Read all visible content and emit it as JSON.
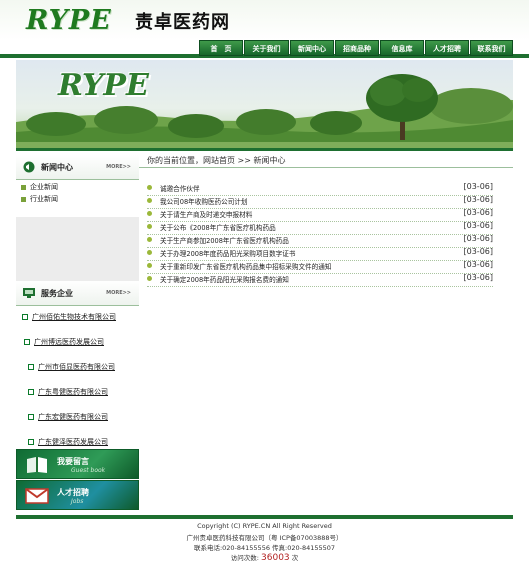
{
  "header": {
    "logo": "RYPE",
    "site_name": "责卓医药网"
  },
  "nav": [
    "首　页",
    "关于我们",
    "新闻中心",
    "招商品种",
    "信息库",
    "人才招聘",
    "联系我们"
  ],
  "banner": {
    "logo": "RYPE"
  },
  "sidebar": {
    "news_center": {
      "title": "新闻中心",
      "more": "MORE>>",
      "items": [
        "企业新闻",
        "行业新闻"
      ]
    },
    "services": {
      "title": "服务企业",
      "more": "MORE>>",
      "companies": [
        "广州佰佑生物技术有限公司",
        "广州博远医药发展公司",
        "广州市佰显医药有限公司",
        "广东粤健医药有限公司",
        "广东宏健医药有限公司",
        "广东健泽医药发展公司"
      ]
    },
    "guestbook": {
      "title": "我要留言",
      "sub": "Guest book"
    },
    "jobs": {
      "title": "人才招聘",
      "sub": "Jobs"
    }
  },
  "main": {
    "breadcrumb": "你的当前位置，网站首页 >> 新闻中心",
    "news": [
      {
        "title": "诚邀合作伙伴",
        "date": "[03-06]"
      },
      {
        "title": "我公司08年收购医药公司计划",
        "date": "[03-06]"
      },
      {
        "title": "关于请生产商及时递交申报材料",
        "date": "[03-06]"
      },
      {
        "title": "关于公布《2008年广东省医疗机构药品",
        "date": "[03-06]"
      },
      {
        "title": "关于生产商参加2008年广东省医疗机构药品",
        "date": "[03-06]"
      },
      {
        "title": "关于办理2008年度药品阳光采购项目数字证书",
        "date": "[03-06]"
      },
      {
        "title": "关于重新印发广东省医疗机构药品集中招标采购文件的通知",
        "date": "[03-06]"
      },
      {
        "title": "关于确定2008年药品阳光采购报名费的通知",
        "date": "[03-06]"
      }
    ]
  },
  "footer": {
    "copyright": "Copyright (C) RYPE.CN All Right Reserved",
    "company": "广州责卓医药科技有限公司（粤 ICP备07003888号）",
    "contact": "联系电话:020-84155556 传真:020-84155507",
    "visits_label": "访问次数:",
    "visits_value": "36003",
    "visits_unit": "次"
  },
  "colors": {
    "brand_green": "#1e6f30",
    "accent_green": "#2f7d2f",
    "counter_red": "#b22222"
  }
}
